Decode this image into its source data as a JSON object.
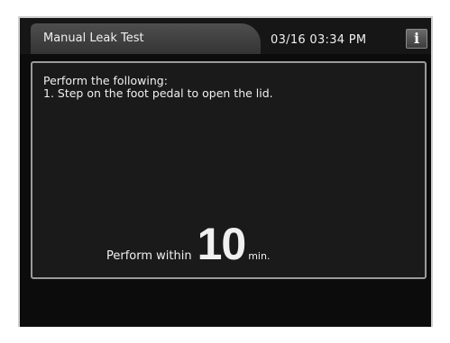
{
  "header": {
    "title": "Manual Leak Test",
    "datetime": "03/16 03:34 PM",
    "info_icon": "info-icon",
    "info_glyph": "i"
  },
  "content": {
    "instruction_heading": "Perform the following:",
    "instruction_step": "1. Step on the foot pedal to open the lid.",
    "timer_prefix": "Perform within",
    "timer_value": "10",
    "timer_unit": "min."
  },
  "colors": {
    "background": "#0c0c0c",
    "panel": "#1a1a1a",
    "tab": "#444444",
    "text": "#f0f0f0",
    "border": "#9a9a9a"
  }
}
